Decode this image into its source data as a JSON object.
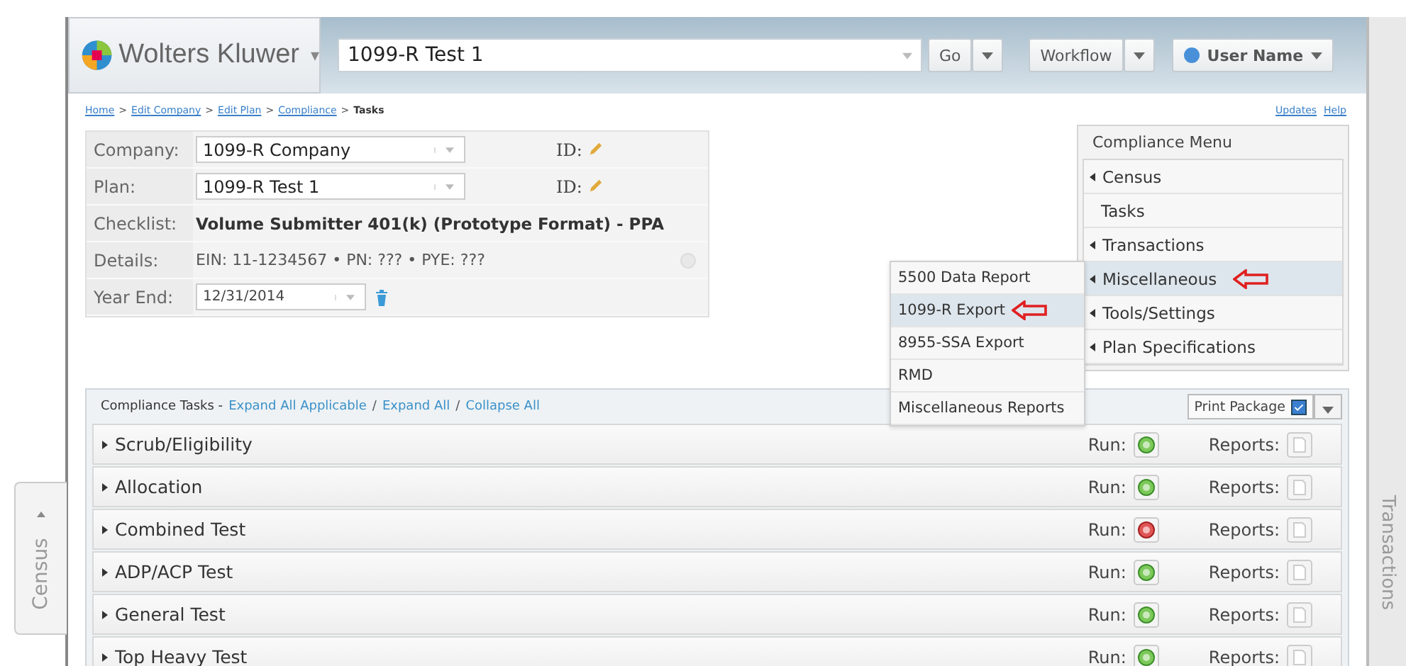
{
  "header": {
    "brand": "Wolters Kluwer",
    "brand_caret": "▾",
    "search": {
      "value": "1099-R Test 1"
    },
    "go": "Go",
    "workflow": "Workflow",
    "user": "User Name"
  },
  "breadcrumb": {
    "links": [
      {
        "label": "Home"
      },
      {
        "sep": ">",
        "label": "Edit Company"
      },
      {
        "sep": ">",
        "label": "Edit Plan"
      },
      {
        "sep": ">",
        "label": "Compliance"
      }
    ],
    "current_sep": ">",
    "current": "Tasks"
  },
  "top_links": [
    "Updates",
    "Help"
  ],
  "form": {
    "rows": [
      {
        "kind": "select",
        "label": "Company:",
        "value": "1099-R Company",
        "id_label": "ID:"
      },
      {
        "kind": "select",
        "label": "Plan:",
        "value": "1099-R Test 1",
        "id_label": "ID:"
      },
      {
        "kind": "bold",
        "label": "Checklist:",
        "value": "Volume Submitter 401(k) (Prototype Format) - PPA"
      },
      {
        "kind": "text",
        "label": "Details:",
        "value": "EIN: 11-1234567 • PN: ??? • PYE: ???"
      },
      {
        "kind": "date",
        "label": "Year End:",
        "value": "12/31/2014"
      }
    ]
  },
  "compliance_menu": {
    "title": "Compliance Menu",
    "items": [
      {
        "label": "Census",
        "expandable": true,
        "selected": false,
        "annotated": false
      },
      {
        "label": "Tasks",
        "expandable": false,
        "selected": false,
        "annotated": false
      },
      {
        "label": "Transactions",
        "expandable": true,
        "selected": false,
        "annotated": false
      },
      {
        "label": "Miscellaneous",
        "expandable": true,
        "selected": true,
        "annotated": true
      },
      {
        "label": "Tools/Settings",
        "expandable": true,
        "selected": false,
        "annotated": false
      },
      {
        "label": "Plan Specifications",
        "expandable": true,
        "selected": false,
        "annotated": false
      }
    ]
  },
  "submenu": [
    {
      "label": "5500 Data Report",
      "selected": false,
      "annotated": false
    },
    {
      "label": "1099-R Export",
      "selected": true,
      "annotated": true
    },
    {
      "label": "8955-SSA Export",
      "selected": false,
      "annotated": false
    },
    {
      "label": "RMD",
      "selected": false,
      "annotated": false
    },
    {
      "label": "Miscellaneous Reports",
      "selected": false,
      "annotated": false
    }
  ],
  "tasks": {
    "title": "Compliance Tasks -",
    "links": [
      {
        "label": "Expand All Applicable"
      },
      {
        "sep": "/",
        "label": "Expand All"
      },
      {
        "sep": "/",
        "label": "Collapse All"
      }
    ],
    "print_package": "Print Package",
    "rows": [
      {
        "label": "Scrub/Eligibility",
        "run_label": "Run:",
        "passed": true,
        "reports_label": "Reports:"
      },
      {
        "label": "Allocation",
        "run_label": "Run:",
        "passed": true,
        "reports_label": "Reports:"
      },
      {
        "label": "Combined Test",
        "run_label": "Run:",
        "passed": false,
        "reports_label": "Reports:"
      },
      {
        "label": "ADP/ACP Test",
        "run_label": "Run:",
        "passed": true,
        "reports_label": "Reports:"
      },
      {
        "label": "General Test",
        "run_label": "Run:",
        "passed": true,
        "reports_label": "Reports:"
      },
      {
        "label": "Top Heavy Test",
        "run_label": "Run:",
        "passed": true,
        "reports_label": "Reports:"
      }
    ]
  },
  "side_tabs": {
    "left": "Census",
    "right": "Transactions"
  }
}
